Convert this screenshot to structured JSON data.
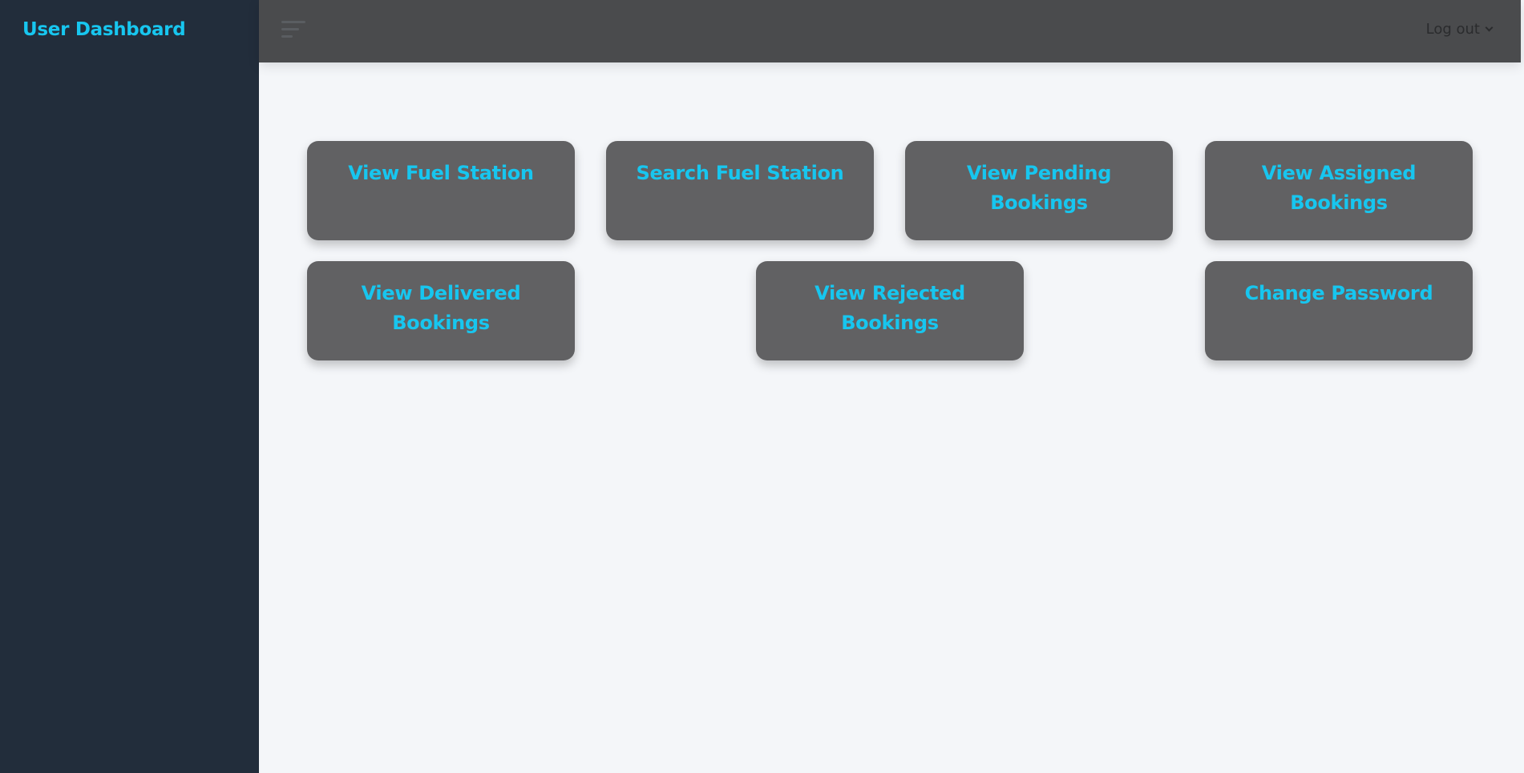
{
  "sidebar": {
    "brand": "User Dashboard"
  },
  "topbar": {
    "menu_icon": "hamburger-menu-icon",
    "logout_label": "Log out",
    "logout_icon": "chevron-down-icon"
  },
  "cards": [
    {
      "label": "View Fuel Station"
    },
    {
      "label": "Search Fuel Station"
    },
    {
      "label": "View Pending Bookings"
    },
    {
      "label": "View Assigned Bookings"
    },
    {
      "label": "View Delivered Bookings"
    },
    {
      "label": "View Rejected Bookings"
    },
    {
      "label": "Change Password"
    }
  ],
  "colors": {
    "sidebar_bg": "#222d3b",
    "topbar_bg": "#4a4b4d",
    "card_bg": "#616163",
    "accent": "#17c6ef",
    "content_bg": "#f4f6f9"
  }
}
